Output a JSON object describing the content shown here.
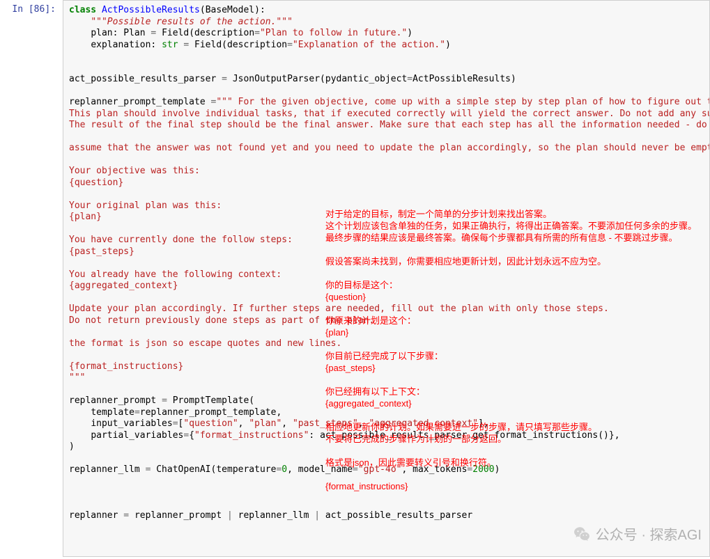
{
  "prompt": "In [86]:",
  "code": {
    "l1": {
      "kw": "class",
      "cls": "ActPossibleResults",
      "base": "BaseModel"
    },
    "l2": "\"\"\"Possible results of the action.\"\"\"",
    "l3": {
      "name": "plan",
      "type": "Plan",
      "func": "Field",
      "arg": "description",
      "val": "\"Plan to follow in future.\""
    },
    "l4": {
      "name": "explanation",
      "type": "str",
      "func": "Field",
      "arg": "description",
      "val": "\"Explanation of the action.\""
    },
    "l7": {
      "lhs": "act_possible_results_parser",
      "rhs": "JsonOutputParser",
      "arg": "pydantic_object",
      "val": "ActPossibleResults"
    },
    "l9a": "replanner_prompt_template",
    "l9b": "\"\"\" For the given objective, come up with a simple step by step plan of how to figure out the answe",
    "l10": "This plan should involve individual tasks, that if executed correctly will yield the correct answer. Do not add any superfluou",
    "l11": "The result of the final step should be the final answer. Make sure that each step has all the information needed - do not skip",
    "l13": "assume that the answer was not found yet and you need to update the plan accordingly, so the plan should never be empty.",
    "l15": "Your objective was this:",
    "l16": "{question}",
    "l18": "Your original plan was this:",
    "l19": "{plan}",
    "l21": "You have currently done the follow steps:",
    "l22": "{past_steps}",
    "l24": "You already have the following context:",
    "l25": "{aggregated_context}",
    "l27": "Update your plan accordingly. If further steps are needed, fill out the plan with only those steps.",
    "l28": "Do not return previously done steps as part of the plan.",
    "l30": "the format is json so escape quotes and new lines.",
    "l32": "{format_instructions}",
    "l33": "\"\"\"",
    "l35a": "replanner_prompt",
    "l35b": "PromptTemplate",
    "l36a": "template",
    "l36b": "replanner_prompt_template",
    "l37a": "input_variables",
    "l37v1": "\"question\"",
    "l37v2": "\"plan\"",
    "l37v3": "\"past_steps\"",
    "l37v4": "\"aggregated_context\"",
    "l38a": "partial_variables",
    "l38k": "\"format_instructions\"",
    "l38v": "act_possible_results_parser",
    "l38m": "get_format_instructions",
    "l41a": "replanner_llm",
    "l41b": "ChatOpenAI",
    "l41t": "temperature",
    "l41tv": "0",
    "l41m": "model_name",
    "l41mv": "\"gpt-4o\"",
    "l41x": "max_tokens",
    "l41xv": "2000",
    "l45a": "replanner",
    "l45b": "replanner_prompt",
    "l45c": "replanner_llm",
    "l45d": "act_possible_results_parser"
  },
  "overlay": {
    "t1": "对于给定的目标，制定一个简单的分步计划来找出答案。",
    "t2": "这个计划应该包含单独的任务，如果正确执行，将得出正确答案。不要添加任何多余的步骤。",
    "t3": "最终步骤的结果应该是最终答案。确保每个步骤都具有所需的所有信息 - 不要跳过步骤。",
    "t4": "假设答案尚未找到，你需要相应地更新计划，因此计划永远不应为空。",
    "t5": "你的目标是这个：",
    "t6": "{question}",
    "t7": "你原来的计划是这个：",
    "t8": "{plan}",
    "t9": "你目前已经完成了以下步骤：",
    "t10": "{past_steps}",
    "t11": "你已经拥有以下上下文：",
    "t12": "{aggregated_context}",
    "t13": "相应地更新你的计划。如果需要进一步的步骤，请只填写那些步骤。",
    "t14": "不要将已完成的步骤作为计划的一部分返回。",
    "t15": "格式是json，因此需要转义引号和换行符。",
    "t16": "{format_instructions}"
  },
  "watermark": "公众号 · 探索AGI"
}
